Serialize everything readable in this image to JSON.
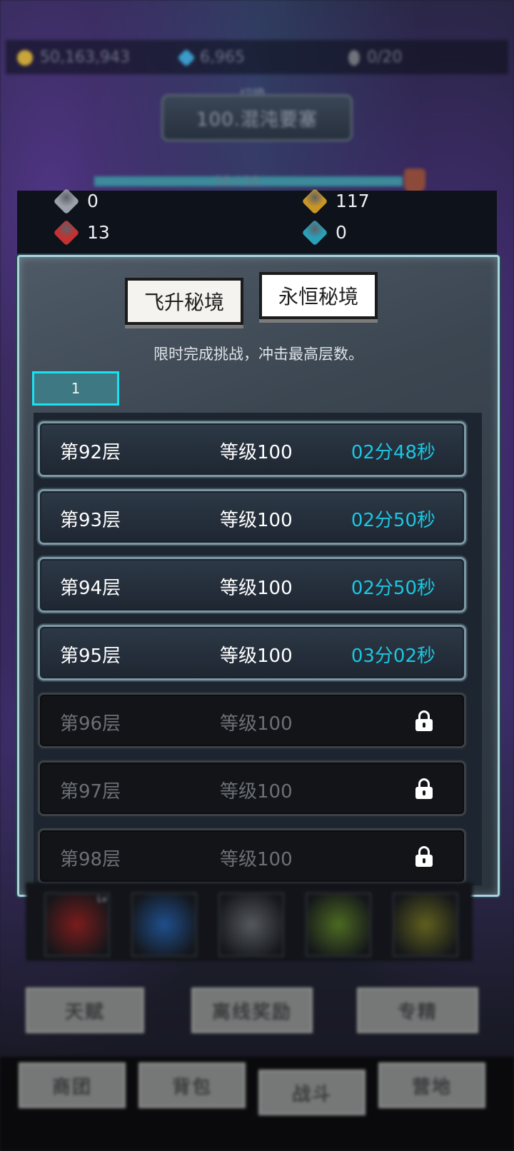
{
  "currency": {
    "gold": "50,163,943",
    "diamonds": "6,965",
    "slots": "0/20"
  },
  "region": {
    "switch_label": "切换",
    "name": "100.混沌要塞"
  },
  "progress": {
    "text": "10 / 10",
    "fraction": 1.0
  },
  "resources": [
    {
      "name": "grey-stone-icon",
      "value": "0",
      "color": "#9aa1aa"
    },
    {
      "name": "gold-rune-icon",
      "value": "117",
      "color": "#c99525"
    },
    {
      "name": "red-gem-icon",
      "value": "13",
      "color": "#c33131"
    },
    {
      "name": "blue-rune-icon",
      "value": "0",
      "color": "#2a9fb8"
    }
  ],
  "modal": {
    "tabs": [
      {
        "label": "飞升秘境",
        "active": false
      },
      {
        "label": "永恒秘境",
        "active": true
      }
    ],
    "description": "限时完成挑战，冲击最高层数。",
    "page_value": "1"
  },
  "floors": [
    {
      "floor": "第92层",
      "level": "等级100",
      "time": "02分48秒",
      "locked": false
    },
    {
      "floor": "第93层",
      "level": "等级100",
      "time": "02分50秒",
      "locked": false
    },
    {
      "floor": "第94层",
      "level": "等级100",
      "time": "02分50秒",
      "locked": false
    },
    {
      "floor": "第95层",
      "level": "等级100",
      "time": "03分02秒",
      "locked": false
    },
    {
      "floor": "第96层",
      "level": "等级100",
      "time": "",
      "locked": true
    },
    {
      "floor": "第97层",
      "level": "等级100",
      "time": "",
      "locked": true
    },
    {
      "floor": "第98层",
      "level": "等级100",
      "time": "",
      "locked": true
    }
  ],
  "skills": [
    {
      "name": "crimson-bow-skill-icon",
      "color": "#7a1c1c"
    },
    {
      "name": "blue-spirit-skill-icon",
      "color": "#1f4f8c"
    },
    {
      "name": "silver-blade-skill-icon",
      "color": "#55585e"
    },
    {
      "name": "green-bow-skill-icon",
      "color": "#4c6a22"
    },
    {
      "name": "olive-bow-skill-icon",
      "color": "#5f5f1e"
    }
  ],
  "actions": {
    "talent": "天赋",
    "offline_rewards": "离线奖励",
    "mastery": "专精"
  },
  "nav": {
    "shop": "商团",
    "bag": "背包",
    "battle": "战斗",
    "camp": "营地"
  },
  "colors": {
    "accent_cyan": "#19e3f2",
    "time_text": "#1cc6e0",
    "modal_border": "#a9d3df"
  }
}
